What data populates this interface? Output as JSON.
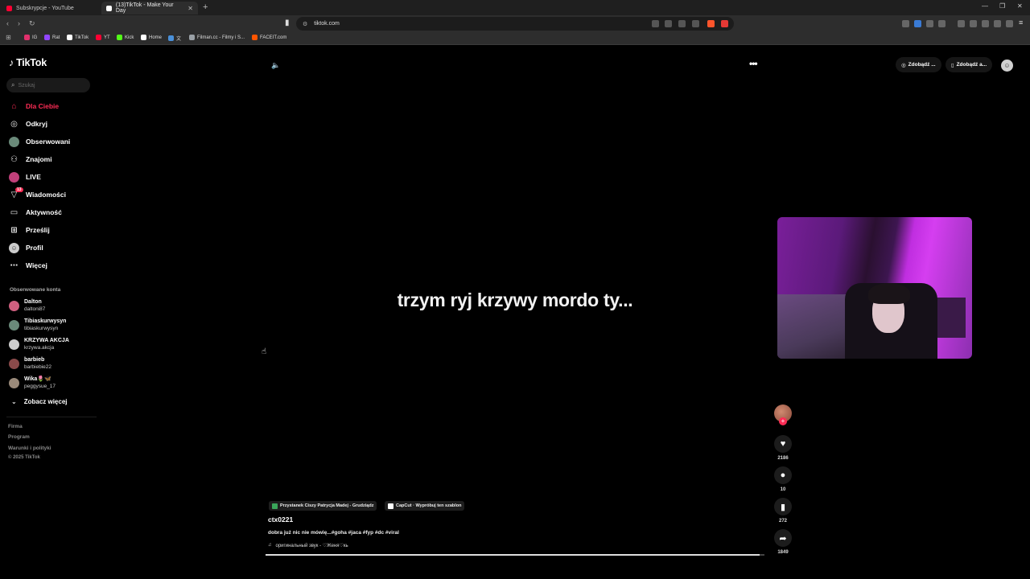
{
  "browser": {
    "tabs": [
      {
        "title": "Subskrypcje - YouTube",
        "active": false,
        "color": "#ff0033"
      },
      {
        "title": "(13)TikTok - Make Your Day",
        "active": true,
        "color": "#ffffff"
      }
    ],
    "url": "tiktok.com",
    "bookmarks": [
      {
        "label": "IG",
        "color": "#e1306c"
      },
      {
        "label": "Rat",
        "color": "#9146ff"
      },
      {
        "label": "TikTok",
        "color": "#ffffff"
      },
      {
        "label": "YT",
        "color": "#ff0033"
      },
      {
        "label": "Kick",
        "color": "#53fc18"
      },
      {
        "label": "Home",
        "color": "#ffffff"
      },
      {
        "label": "文",
        "color": "#4a90d9"
      },
      {
        "label": "Filman.cc - Filmy i S...",
        "color": "#9aa0a6"
      },
      {
        "label": "FACEIT.com",
        "color": "#ff5500"
      }
    ],
    "shield_badge": "1"
  },
  "app": {
    "logo": "TikTok",
    "search_placeholder": "Szukaj",
    "nav": [
      {
        "label": "Dla Ciebie",
        "icon": "home-icon",
        "active": true
      },
      {
        "label": "Odkryj",
        "icon": "compass-icon",
        "active": false
      },
      {
        "label": "Obserwowani",
        "icon": "avatar-icon",
        "active": false
      },
      {
        "label": "Znajomi",
        "icon": "friends-icon",
        "active": false
      },
      {
        "label": "LIVE",
        "icon": "live-icon",
        "active": false
      },
      {
        "label": "Wiadomości",
        "icon": "messages-icon",
        "active": false,
        "badge": "13"
      },
      {
        "label": "Aktywność",
        "icon": "activity-icon",
        "active": false
      },
      {
        "label": "Prześlij",
        "icon": "upload-icon",
        "active": false
      },
      {
        "label": "Profil",
        "icon": "profile-icon",
        "active": false
      },
      {
        "label": "Więcej",
        "icon": "more-icon",
        "active": false
      }
    ],
    "followed_title": "Obserwowane konta",
    "followed": [
      {
        "name": "Dalton",
        "user": "daltoni87",
        "color": "#d06080"
      },
      {
        "name": "Tibiaskurwysyn",
        "user": "tibiaskurwysyn",
        "color": "#6a8a7a"
      },
      {
        "name": "KRZYWA AKCJA",
        "user": "krzywa.akcja",
        "color": "#cccccc"
      },
      {
        "name": "barbieb",
        "user": "barbiebie22",
        "color": "#8a4a4a"
      },
      {
        "name": "Wika🌷🦋",
        "user": "peggysue_17",
        "color": "#9a8a7a"
      }
    ],
    "see_more": "Zobacz więcej",
    "footer": [
      "Firma",
      "Program",
      "Warunki i polityki",
      "© 2025 TikTok"
    ],
    "top_buttons": [
      "Zdobądź ...",
      "Zdobądź a..."
    ]
  },
  "video": {
    "caption": "trzym ryj krzywy mordo ty...",
    "author": "ctx0221",
    "description": "dobra już nic nie mówię...#goha #jaca #fyp #dc #viral",
    "music": "оригинальный звук - ♡Женя♡кь",
    "chips": [
      "Przystanek Ciszy Patrycja Madej - Grudziądz",
      "CapCut · Wypróbuj ten szablon"
    ],
    "progress": 0.99,
    "actions": {
      "likes": "2186",
      "comments": "10",
      "saves": "272",
      "shares": "1849"
    }
  }
}
